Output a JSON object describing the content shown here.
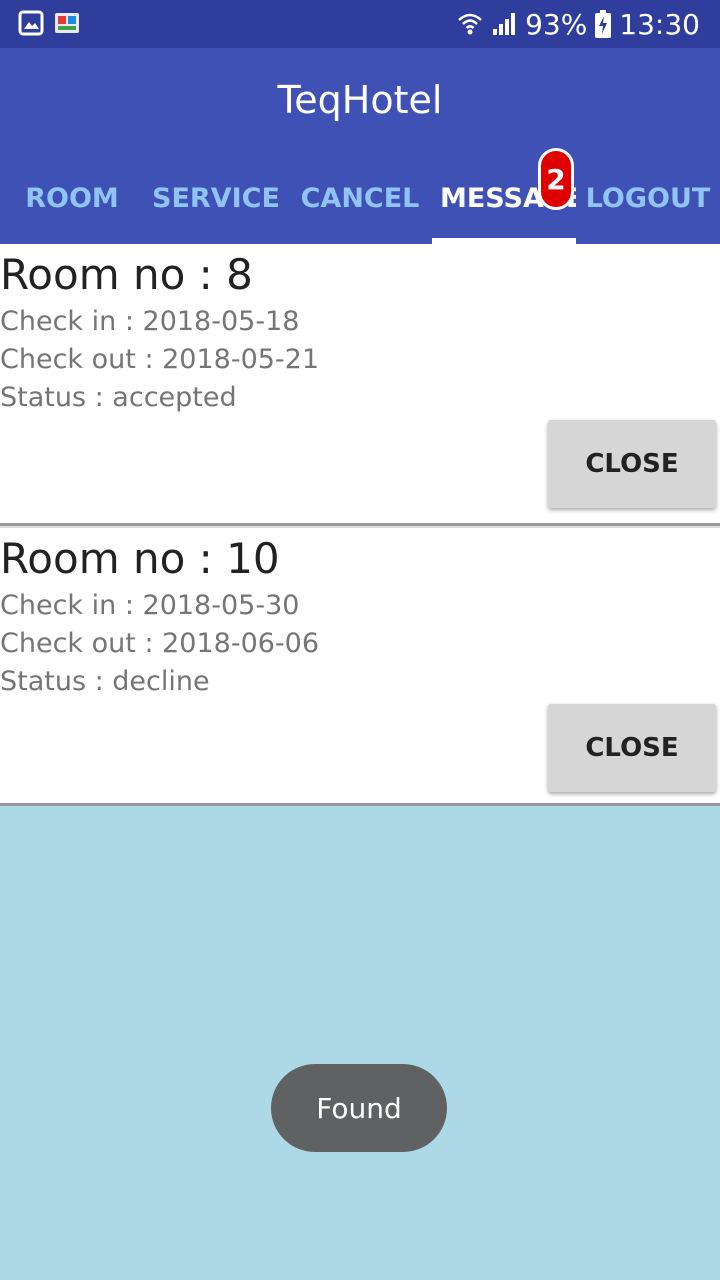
{
  "status_bar": {
    "left_icons": [
      "gallery-icon",
      "app-notification-icon"
    ],
    "battery_percent": "93%",
    "time": "13:30"
  },
  "app": {
    "title": "TeqHotel",
    "theme_color": "#3f51b5"
  },
  "tabs": [
    {
      "label": "ROOM",
      "active": false
    },
    {
      "label": "SERVICE",
      "active": false
    },
    {
      "label": "CANCEL",
      "active": false
    },
    {
      "label": "MESSAGE",
      "active": true
    },
    {
      "label": "LOGOUT",
      "active": false
    }
  ],
  "badge": {
    "count": "2",
    "color": "#e00000"
  },
  "bookings": [
    {
      "room": "Room no : 8",
      "check_in": "Check in : 2018-05-18",
      "check_out": "Check out : 2018-05-21",
      "status": "Status : accepted",
      "button_label": "CLOSE"
    },
    {
      "room": "Room no : 10",
      "check_in": "Check in : 2018-05-30",
      "check_out": "Check out : 2018-06-06",
      "status": "Status : decline",
      "button_label": "CLOSE"
    }
  ],
  "toast": {
    "text": "Found"
  },
  "background_color": "#add8e6"
}
